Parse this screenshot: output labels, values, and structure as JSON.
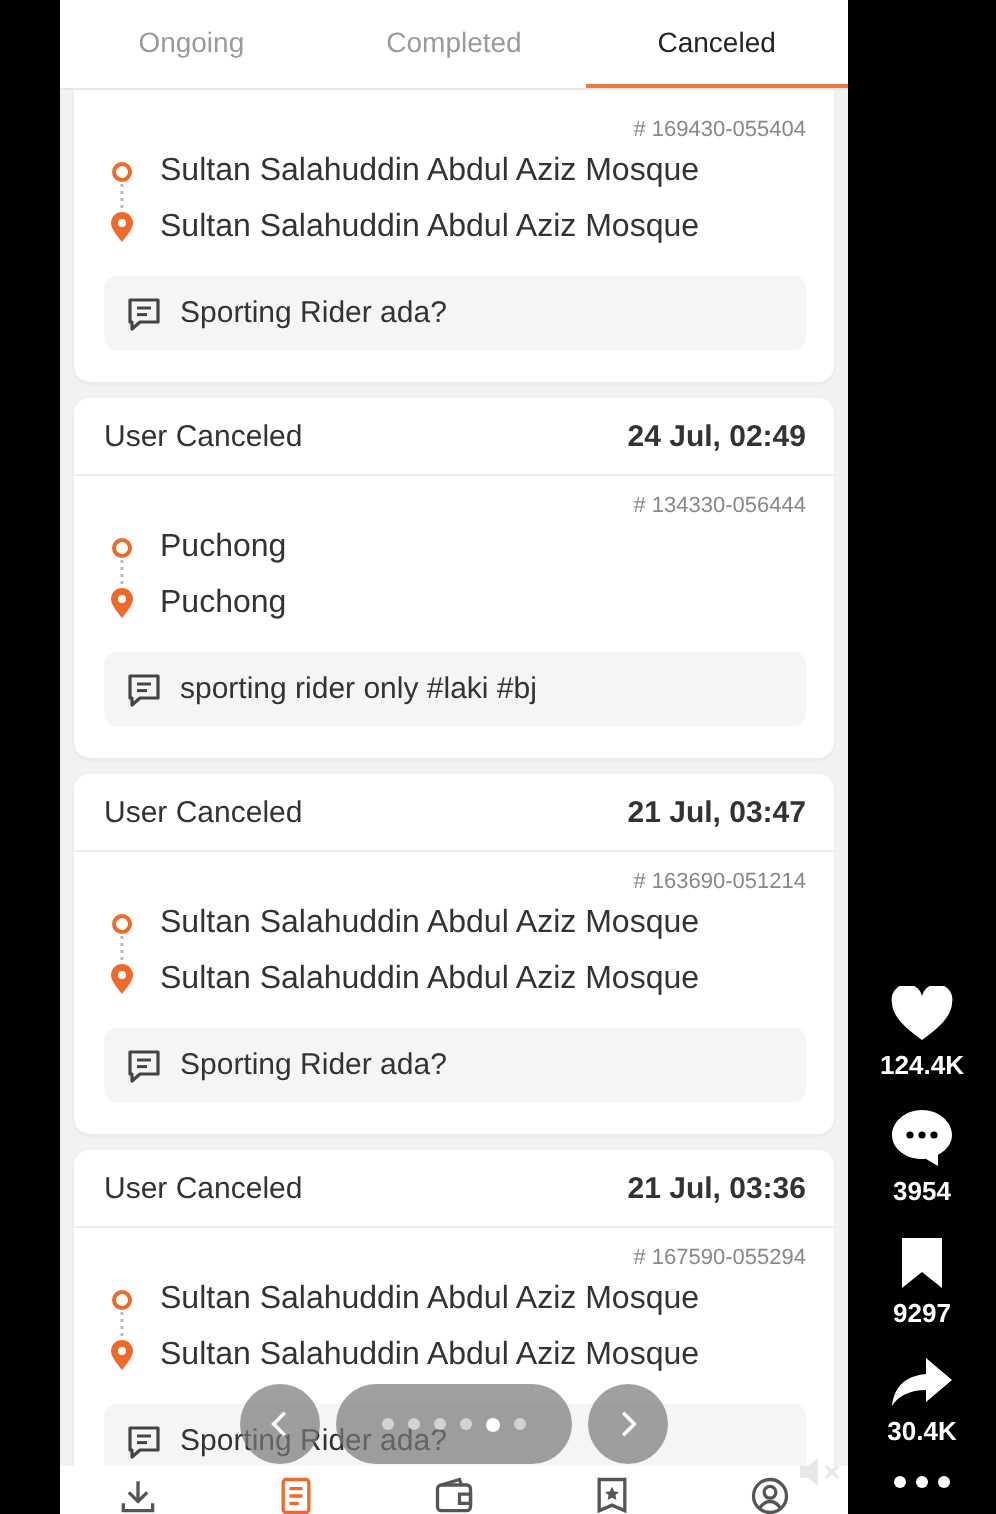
{
  "tabs": [
    {
      "label": "Ongoing",
      "selected": false
    },
    {
      "label": "Completed",
      "selected": false
    },
    {
      "label": "Canceled",
      "selected": true
    }
  ],
  "orders": [
    {
      "number": "# 169430-055404",
      "pickup": "Sultan Salahuddin Abdul Aziz Mosque",
      "dropoff": "Sultan Salahuddin Abdul Aziz Mosque",
      "note": "Sporting Rider ada?"
    },
    {
      "status": "User Canceled",
      "date": "24 Jul, 02:49",
      "number": "# 134330-056444",
      "pickup": "Puchong",
      "dropoff": "Puchong",
      "note": "sporting rider only #laki #bj"
    },
    {
      "status": "User Canceled",
      "date": "21 Jul, 03:47",
      "number": "# 163690-051214",
      "pickup": "Sultan Salahuddin Abdul Aziz Mosque",
      "dropoff": "Sultan Salahuddin Abdul Aziz Mosque",
      "note": "Sporting Rider ada?"
    },
    {
      "status": "User Canceled",
      "date": "21 Jul, 03:36",
      "number": "# 167590-055294",
      "pickup": "Sultan Salahuddin Abdul Aziz Mosque",
      "dropoff": "Sultan Salahuddin Abdul Aziz Mosque",
      "note": "Sporting Rider ada?"
    }
  ],
  "bottom_nav": [
    {
      "kind": "download",
      "selected": false
    },
    {
      "kind": "orders",
      "selected": true
    },
    {
      "kind": "wallet",
      "selected": false
    },
    {
      "kind": "badge",
      "selected": false
    },
    {
      "kind": "profile",
      "selected": false
    }
  ],
  "carousel_dots": [
    {
      "selected": false
    },
    {
      "selected": false
    },
    {
      "selected": false
    },
    {
      "selected": false
    },
    {
      "selected": true
    },
    {
      "selected": false
    }
  ],
  "actions": [
    {
      "kind": "like",
      "count": "124.4K"
    },
    {
      "kind": "comment",
      "count": "3954"
    },
    {
      "kind": "save",
      "count": "9297"
    },
    {
      "kind": "share",
      "count": "30.4K"
    },
    {
      "kind": "more"
    }
  ]
}
